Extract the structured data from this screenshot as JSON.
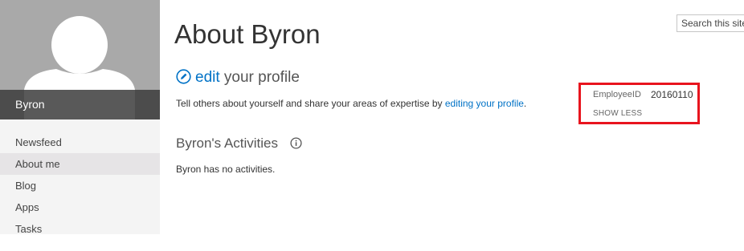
{
  "sidebar": {
    "user_name": "Byron",
    "nav_items": [
      {
        "label": "Newsfeed",
        "selected": false
      },
      {
        "label": "About me",
        "selected": true
      },
      {
        "label": "Blog",
        "selected": false
      },
      {
        "label": "Apps",
        "selected": false
      },
      {
        "label": "Tasks",
        "selected": false
      }
    ]
  },
  "search": {
    "placeholder": "Search this site"
  },
  "main": {
    "title": "About Byron",
    "edit_word": "edit",
    "edit_rest": "your profile",
    "tell_prefix": "Tell others about yourself and share your areas of expertise by ",
    "tell_link": "editing your profile",
    "tell_suffix": ".",
    "activities_heading": "Byron's Activities",
    "no_activities": "Byron has no activities."
  },
  "employee": {
    "label": "EmployeeID",
    "value": "20160110",
    "toggle": "SHOW LESS"
  },
  "colors": {
    "link": "#0072c6",
    "highlight_border": "#e8141e",
    "photo_bg": "#a9a9a9"
  },
  "icons": {
    "avatar": "person-silhouette-icon",
    "edit": "pencil-icon",
    "info": "info-icon"
  }
}
